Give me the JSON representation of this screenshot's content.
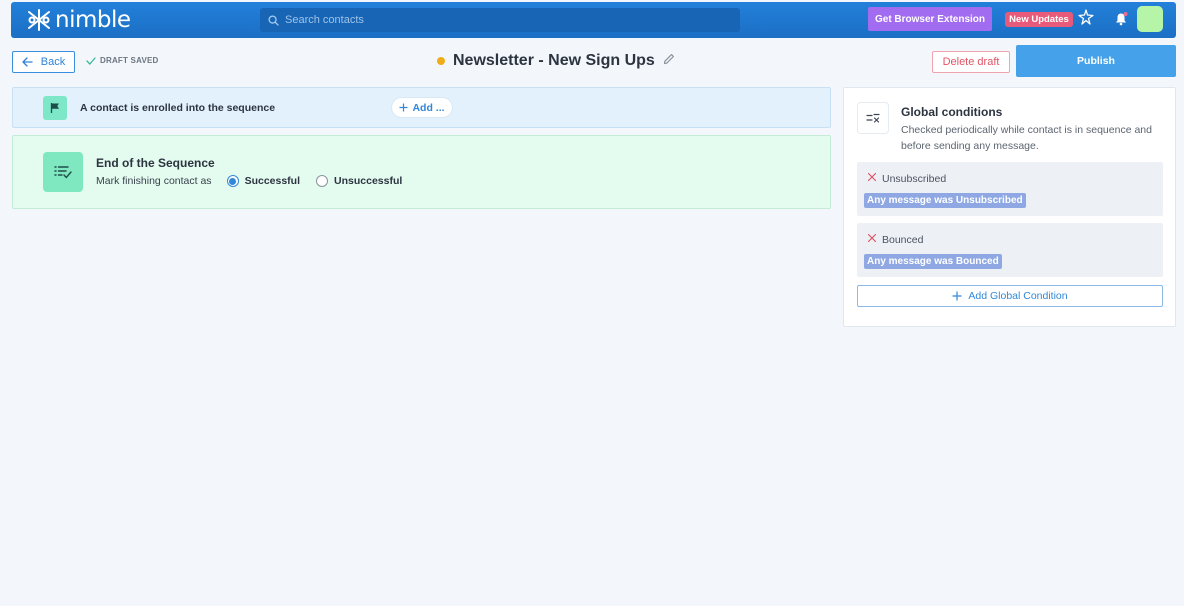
{
  "app": {
    "brand": "nimble"
  },
  "search": {
    "placeholder": "Search contacts"
  },
  "topbar": {
    "extension_label": "Get Browser Extension",
    "updates_label": "New Updates"
  },
  "header": {
    "back_label": "Back",
    "draft_status": "DRAFT SAVED",
    "title": "Newsletter - New Sign Ups",
    "delete_label": "Delete draft",
    "publish_label": "Publish"
  },
  "trigger": {
    "label": "A contact is enrolled into the sequence",
    "add_label": "Add ..."
  },
  "end_step": {
    "title": "End of the Sequence",
    "mark_label": "Mark finishing contact as",
    "options": [
      {
        "label": "Successful",
        "selected": true
      },
      {
        "label": "Unsuccessful",
        "selected": false
      }
    ]
  },
  "global_conditions": {
    "title": "Global conditions",
    "description": "Checked periodically while contact is in sequence and before sending any message.",
    "conditions": [
      {
        "name": "Unsubscribed",
        "rule": "Any message was Unsubscribed"
      },
      {
        "name": "Bounced",
        "rule": "Any message was Bounced"
      }
    ],
    "add_label": "Add Global Condition"
  },
  "colors": {
    "topbar": "#1f78d1",
    "accent": "#3188d8",
    "draft_dot": "#f0ac18",
    "extension": "#a16cf0",
    "updates": "#e85a7a",
    "delete": "#e05565"
  }
}
